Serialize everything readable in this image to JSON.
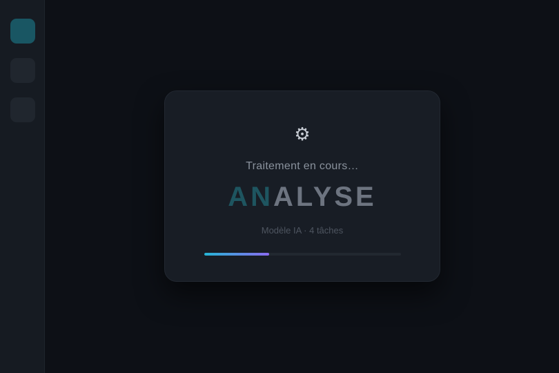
{
  "sidebar": {
    "items": [
      {
        "name": "nav-item-1",
        "active": true
      },
      {
        "name": "nav-item-2",
        "active": false
      },
      {
        "name": "nav-item-3",
        "active": false
      }
    ]
  },
  "loader": {
    "icon": "gear-icon",
    "icon_glyph": "⚙",
    "status": "Traitement en cours…",
    "word_highlight": "AN",
    "word_rest": "ALYSE",
    "meta": "Modèle IA · 4 tâches",
    "progress": 0.33
  },
  "colors": {
    "background": "#0d1016",
    "sidebar": "#161b22",
    "active_tile": "#195663",
    "card": "#181d25",
    "highlight_text": "#1e5560",
    "progress_start": "#25b5d6",
    "progress_end": "#8a6bf0"
  }
}
